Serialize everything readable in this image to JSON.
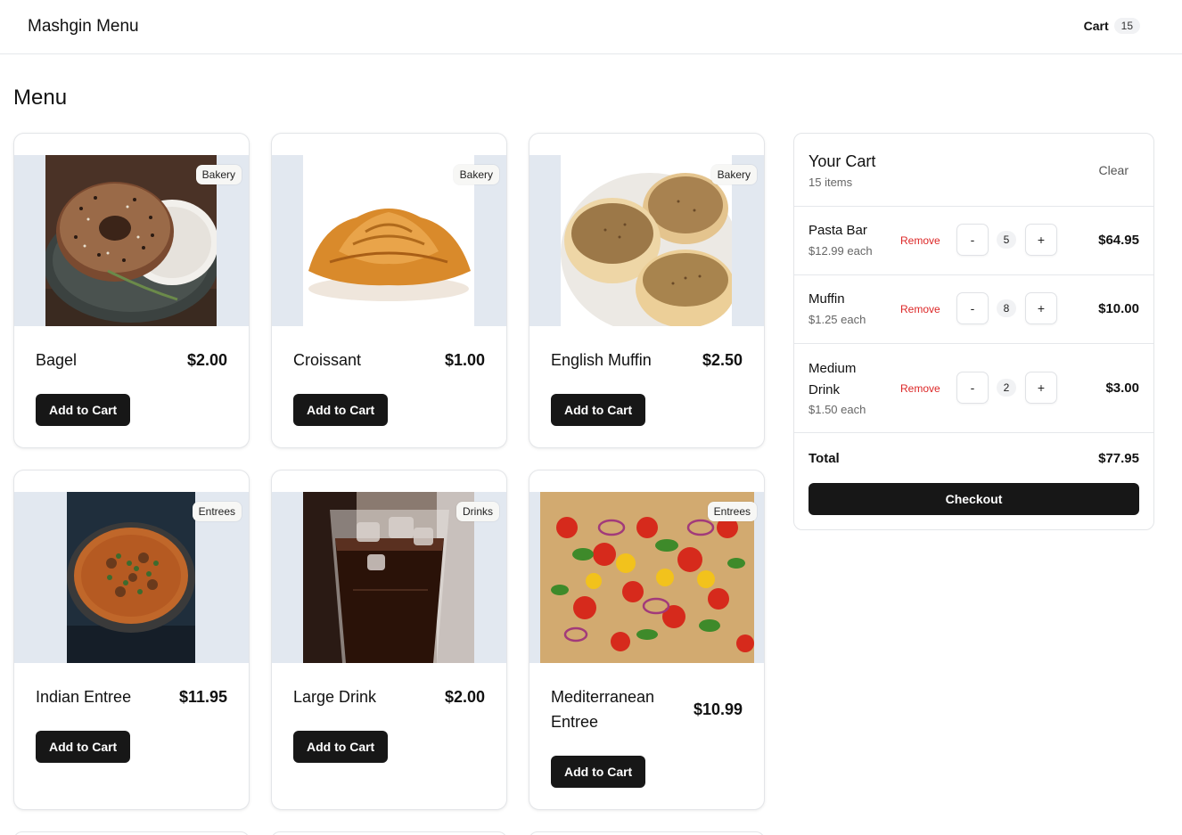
{
  "header": {
    "brand": "Mashgin Menu",
    "cart_label": "Cart",
    "cart_count": "15"
  },
  "page_title": "Menu",
  "menu_items": [
    {
      "name": "Bagel",
      "price": "$2.00",
      "category": "Bakery",
      "button": "Add to Cart"
    },
    {
      "name": "Croissant",
      "price": "$1.00",
      "category": "Bakery",
      "button": "Add to Cart"
    },
    {
      "name": "English Muffin",
      "price": "$2.50",
      "category": "Bakery",
      "button": "Add to Cart"
    },
    {
      "name": "Indian Entree",
      "price": "$11.95",
      "category": "Entrees",
      "button": "Add to Cart"
    },
    {
      "name": "Large Drink",
      "price": "$2.00",
      "category": "Drinks",
      "button": "Add to Cart"
    },
    {
      "name": "Mediterranean Entree",
      "price": "$10.99",
      "category": "Entrees",
      "button": "Add to Cart"
    }
  ],
  "cart": {
    "title": "Your Cart",
    "subtitle": "15 items",
    "clear_label": "Clear",
    "remove_label": "Remove",
    "minus_label": "-",
    "plus_label": "+",
    "items": [
      {
        "name": "Pasta Bar",
        "each": "$12.99 each",
        "qty": "5",
        "line_total": "$64.95"
      },
      {
        "name": "Muffin",
        "each": "$1.25 each",
        "qty": "8",
        "line_total": "$10.00"
      },
      {
        "name": "Medium Drink",
        "each": "$1.50 each",
        "qty": "2",
        "line_total": "$3.00"
      }
    ],
    "total_label": "Total",
    "total_value": "$77.95",
    "checkout_label": "Checkout"
  }
}
